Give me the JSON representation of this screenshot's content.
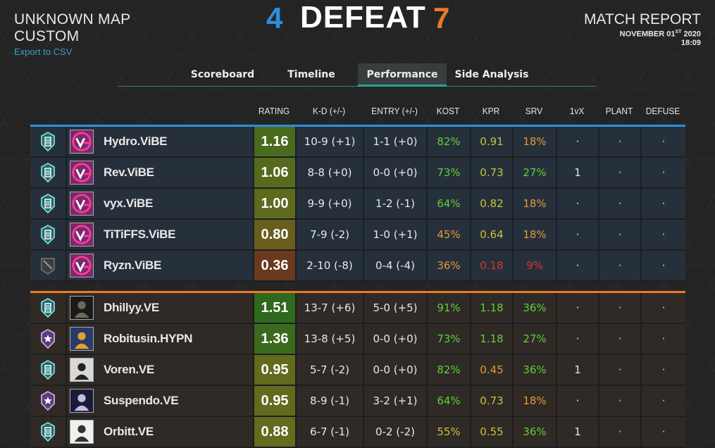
{
  "header": {
    "map_name": "UNKNOWN MAP",
    "mode": "CUSTOM",
    "export_label": "Export to CSV",
    "score_blue": "4",
    "result": "DEFEAT",
    "score_orange": "7",
    "report_title": "MATCH REPORT",
    "date_month_day": "NOVEMBER 01",
    "date_suffix": "ST",
    "date_year": " 2020",
    "time": "18:09"
  },
  "tabs": [
    {
      "label": "Scoreboard"
    },
    {
      "label": "Timeline"
    },
    {
      "label": "Performance",
      "active": true
    },
    {
      "label": "Side Analysis"
    }
  ],
  "columns": [
    "RATING",
    "K-D (+/-)",
    "ENTRY (+/-)",
    "KOST",
    "KPR",
    "SRV",
    "1vX",
    "PLANT",
    "DEFUSE"
  ],
  "colors": {
    "blue": "#2b8fe0",
    "orange": "#ea7a2a",
    "good": "#5fcf3a",
    "mid": "#c9c23a",
    "warn": "#e09a3a",
    "bad": "#d03a2a"
  },
  "blue_team": [
    {
      "name": "Hydro.ViBE",
      "rank_icon": "diamond-rank-icon",
      "avatar": "vibe-logo-avatar",
      "rating": "1.16",
      "rating_color": "#4a6a1e",
      "kd": "10-9 (+1)",
      "entry": "1-1 (+0)",
      "kost": "82%",
      "kost_color": "#5fcf3a",
      "kpr": "0.91",
      "kpr_color": "#c9c23a",
      "srv": "18%",
      "srv_color": "#e09a3a",
      "onevx": "·",
      "plant": "·",
      "defuse": "·"
    },
    {
      "name": "Rev.ViBE",
      "rank_icon": "diamond-rank-icon",
      "avatar": "vibe-logo-avatar",
      "rating": "1.06",
      "rating_color": "#566a1e",
      "kd": "8-8 (+0)",
      "entry": "0-0 (+0)",
      "kost": "73%",
      "kost_color": "#5fcf3a",
      "kpr": "0.73",
      "kpr_color": "#c9c23a",
      "srv": "27%",
      "srv_color": "#5fcf3a",
      "onevx": "1",
      "plant": "·",
      "defuse": "·"
    },
    {
      "name": "vyx.ViBE",
      "rank_icon": "diamond-rank-icon",
      "avatar": "vibe-logo-avatar",
      "rating": "1.00",
      "rating_color": "#5e6a1e",
      "kd": "9-9 (+0)",
      "entry": "1-2 (-1)",
      "kost": "64%",
      "kost_color": "#5fcf3a",
      "kpr": "0.82",
      "kpr_color": "#c9c23a",
      "srv": "18%",
      "srv_color": "#e09a3a",
      "onevx": "·",
      "plant": "·",
      "defuse": "·"
    },
    {
      "name": "TiTiFFS.ViBE",
      "rank_icon": "diamond-rank-icon",
      "avatar": "vibe-logo-avatar",
      "rating": "0.80",
      "rating_color": "#6a5e1e",
      "kd": "7-9 (-2)",
      "entry": "1-0 (+1)",
      "kost": "45%",
      "kost_color": "#e09a3a",
      "kpr": "0.64",
      "kpr_color": "#c9c23a",
      "srv": "18%",
      "srv_color": "#e09a3a",
      "onevx": "·",
      "plant": "·",
      "defuse": "·"
    },
    {
      "name": "Ryzn.ViBE",
      "rank_icon": "unranked-icon",
      "avatar": "vibe-logo-avatar",
      "rating": "0.36",
      "rating_color": "#6a3a1e",
      "kd": "2-10 (-8)",
      "entry": "0-4 (-4)",
      "kost": "36%",
      "kost_color": "#e09a3a",
      "kpr": "0.18",
      "kpr_color": "#d03a2a",
      "srv": "9%",
      "srv_color": "#d03a2a",
      "onevx": "·",
      "plant": "·",
      "defuse": "·"
    }
  ],
  "orange_team": [
    {
      "name": "Dhillyy.VE",
      "rank_icon": "diamond-rank-icon",
      "avatar": "player-avatar",
      "rating": "1.51",
      "rating_color": "#2e6a1e",
      "kd": "13-7 (+6)",
      "entry": "5-0 (+5)",
      "kost": "91%",
      "kost_color": "#5fcf3a",
      "kpr": "1.18",
      "kpr_color": "#5fcf3a",
      "srv": "36%",
      "srv_color": "#5fcf3a",
      "onevx": "·",
      "plant": "·",
      "defuse": "·"
    },
    {
      "name": "Robitusin.HYPN",
      "rank_icon": "champion-rank-icon",
      "avatar": "player-avatar",
      "rating": "1.36",
      "rating_color": "#3a6a1e",
      "kd": "13-8 (+5)",
      "entry": "0-0 (+0)",
      "kost": "73%",
      "kost_color": "#5fcf3a",
      "kpr": "1.18",
      "kpr_color": "#5fcf3a",
      "srv": "27%",
      "srv_color": "#5fcf3a",
      "onevx": "·",
      "plant": "·",
      "defuse": "·"
    },
    {
      "name": "Voren.VE",
      "rank_icon": "diamond-rank-icon",
      "avatar": "player-avatar",
      "rating": "0.95",
      "rating_color": "#626a1e",
      "kd": "5-7 (-2)",
      "entry": "0-0 (+0)",
      "kost": "82%",
      "kost_color": "#5fcf3a",
      "kpr": "0.45",
      "kpr_color": "#e09a3a",
      "srv": "36%",
      "srv_color": "#5fcf3a",
      "onevx": "1",
      "plant": "·",
      "defuse": "·"
    },
    {
      "name": "Suspendo.VE",
      "rank_icon": "champion-rank-icon",
      "avatar": "player-avatar",
      "rating": "0.95",
      "rating_color": "#626a1e",
      "kd": "8-9 (-1)",
      "entry": "3-2 (+1)",
      "kost": "64%",
      "kost_color": "#5fcf3a",
      "kpr": "0.73",
      "kpr_color": "#c9c23a",
      "srv": "18%",
      "srv_color": "#e09a3a",
      "onevx": "·",
      "plant": "·",
      "defuse": "·"
    },
    {
      "name": "Orbitt.VE",
      "rank_icon": "diamond-rank-icon",
      "avatar": "player-avatar",
      "rating": "0.88",
      "rating_color": "#666a1e",
      "kd": "6-7 (-1)",
      "entry": "0-2 (-2)",
      "kost": "55%",
      "kost_color": "#c9c23a",
      "kpr": "0.55",
      "kpr_color": "#c9c23a",
      "srv": "36%",
      "srv_color": "#5fcf3a",
      "onevx": "1",
      "plant": "·",
      "defuse": "·"
    }
  ]
}
